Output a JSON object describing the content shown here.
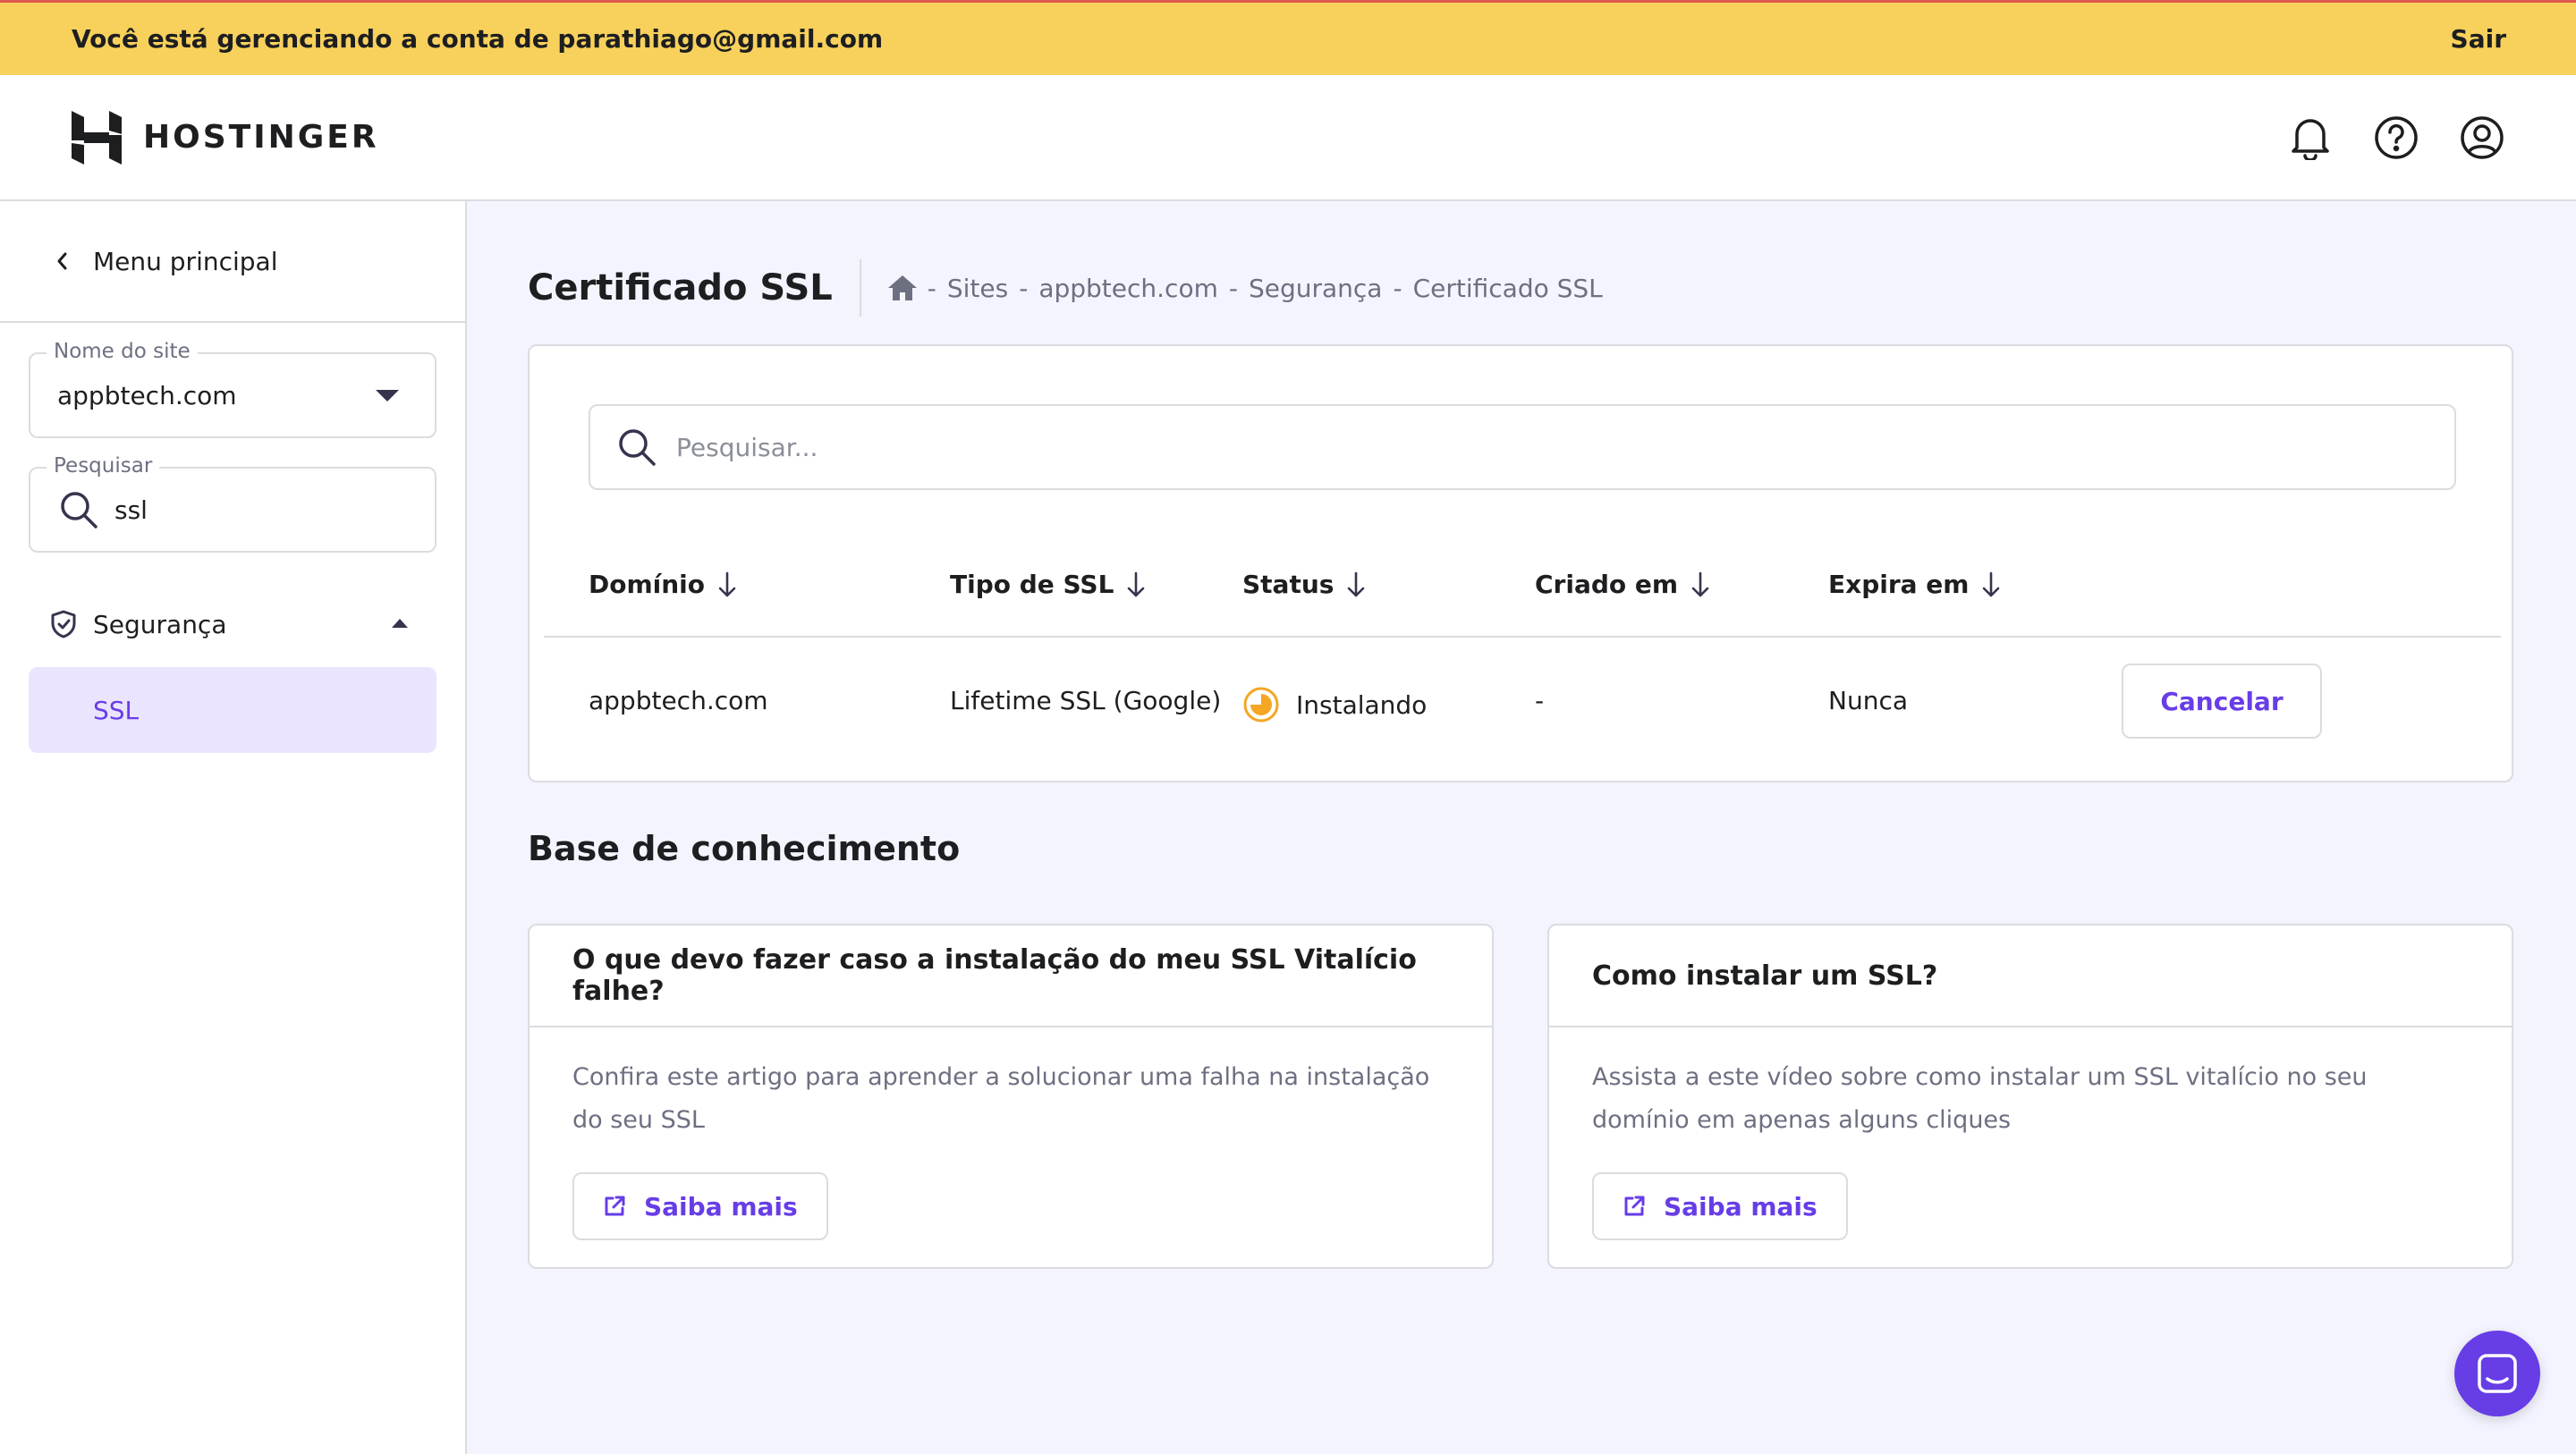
{
  "banner": {
    "text": "Você está gerenciando a conta de parathiago@gmail.com",
    "exit_label": "Sair"
  },
  "header": {
    "brand": "HOSTINGER",
    "icons": [
      "bell-icon",
      "help-icon",
      "account-icon"
    ]
  },
  "sidebar": {
    "back_label": "Menu principal",
    "site_select": {
      "label": "Nome do site",
      "value": "appbtech.com"
    },
    "search": {
      "label": "Pesquisar",
      "value": "ssl"
    },
    "section": {
      "label": "Segurança",
      "icon": "shield-icon"
    },
    "active_item": {
      "label": "SSL"
    }
  },
  "page": {
    "title": "Certificado SSL",
    "breadcrumb": [
      "Sites",
      "appbtech.com",
      "Segurança",
      "Certificado SSL"
    ],
    "breadcrumb_separator": "-"
  },
  "ssl_table": {
    "search_placeholder": "Pesquisar...",
    "columns": [
      "Domínio",
      "Tipo de SSL",
      "Status",
      "Criado em",
      "Expira em"
    ],
    "rows": [
      {
        "domain": "appbtech.com",
        "type": "Lifetime SSL (Google)",
        "status": "Instalando",
        "created": "-",
        "expires": "Nunca",
        "action": "Cancelar"
      }
    ]
  },
  "knowledge_base": {
    "title": "Base de conhecimento",
    "cards": [
      {
        "title": "O que devo fazer caso a instalação do meu SSL Vitalício falhe?",
        "description": "Confira este artigo para aprender a solucionar uma falha na instalação do seu SSL",
        "button": "Saiba mais"
      },
      {
        "title": "Como instalar um SSL?",
        "description": "Assista a este vídeo sobre como instalar um SSL vitalício no seu domínio em apenas alguns cliques",
        "button": "Saiba mais"
      }
    ]
  },
  "colors": {
    "banner": "#f8d15c",
    "accent": "#673de6",
    "status_pending": "#f5a623",
    "page_bg": "#f4f4fe"
  }
}
